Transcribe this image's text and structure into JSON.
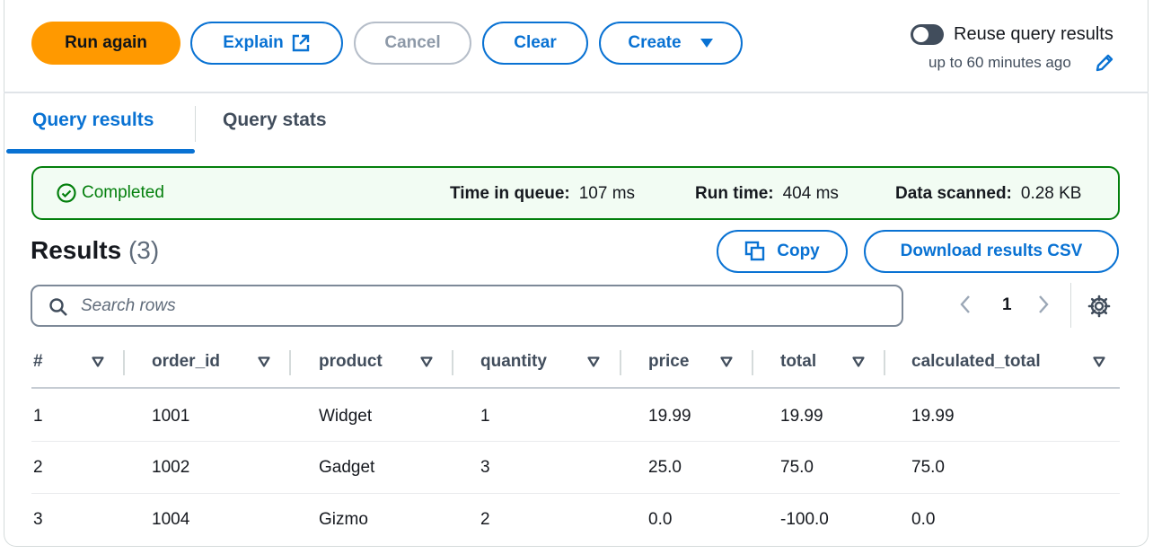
{
  "toolbar": {
    "run_again": "Run again",
    "explain": "Explain",
    "cancel": "Cancel",
    "clear": "Clear",
    "create": "Create",
    "reuse_label": "Reuse query results",
    "reuse_sub": "up to 60 minutes ago",
    "reuse_enabled": false
  },
  "tabs": [
    {
      "label": "Query results",
      "active": true
    },
    {
      "label": "Query stats",
      "active": false
    }
  ],
  "status": {
    "state": "Completed",
    "time_in_queue_label": "Time in queue:",
    "time_in_queue": "107 ms",
    "run_time_label": "Run time:",
    "run_time": "404 ms",
    "data_scanned_label": "Data scanned:",
    "data_scanned": "0.28 KB"
  },
  "results": {
    "title": "Results",
    "count": "(3)",
    "copy": "Copy",
    "download": "Download results CSV",
    "search_placeholder": "Search rows",
    "page": "1"
  },
  "table": {
    "columns": [
      "#",
      "order_id",
      "product",
      "quantity",
      "price",
      "total",
      "calculated_total"
    ],
    "rows": [
      [
        "1",
        "1001",
        "Widget",
        "1",
        "19.99",
        "19.99",
        "19.99"
      ],
      [
        "2",
        "1002",
        "Gadget",
        "3",
        "25.0",
        "75.0",
        "75.0"
      ],
      [
        "3",
        "1004",
        "Gizmo",
        "2",
        "0.0",
        "-100.0",
        "0.0"
      ]
    ]
  },
  "colors": {
    "primary": "#ff9900",
    "link_blue": "#0972d3",
    "success_green": "#037f0c",
    "success_bg": "#f2fcf3"
  }
}
